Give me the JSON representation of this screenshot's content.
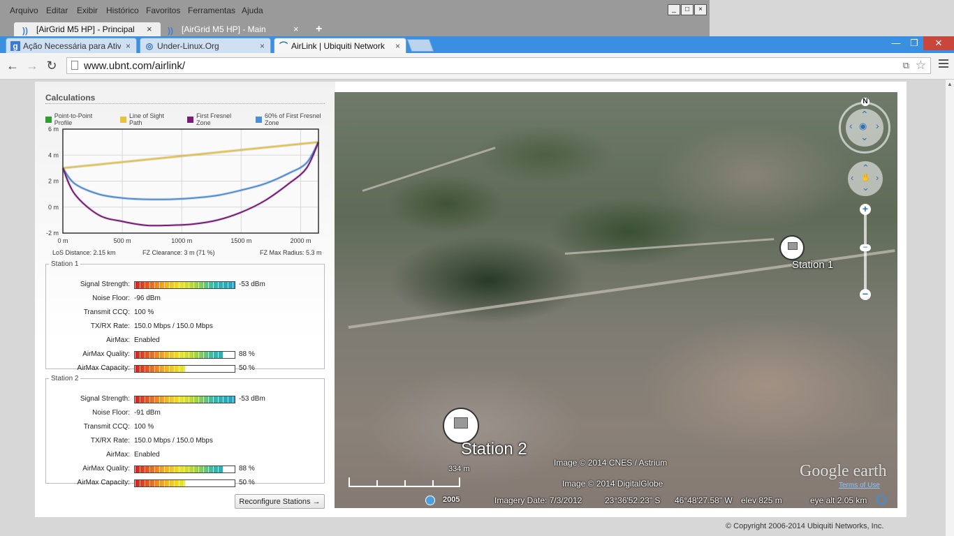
{
  "firefox": {
    "menu": [
      "Arquivo",
      "Editar",
      "Exibir",
      "Histórico",
      "Favoritos",
      "Ferramentas",
      "Ajuda"
    ],
    "tabs": [
      {
        "label": "[AirGrid M5 HP] - Principal",
        "close": "×"
      },
      {
        "label": "[AirGrid M5 HP] - Main",
        "close": "×"
      }
    ],
    "new_tab": "+",
    "window_controls": [
      "_",
      "□",
      "×"
    ]
  },
  "chrome": {
    "tabs": [
      {
        "label": "Ação Necessária para Ativ",
        "icon": "g",
        "close": "×"
      },
      {
        "label": "Under-Linux.Org",
        "icon": "◎",
        "close": "×"
      },
      {
        "label": "AirLink | Ubiquiti Network",
        "icon": "⌒",
        "close": "×"
      }
    ],
    "window_controls": {
      "minimize": "—",
      "restore": "❐",
      "close": "✕"
    },
    "back": "←",
    "forward": "→",
    "reload": "↻",
    "url": "www.ubnt.com/airlink/",
    "translate_icon": "⧉",
    "star_icon": "☆"
  },
  "calc": {
    "title": "Calculations",
    "legend": [
      {
        "label": "Point-to-Point Profile",
        "color": "#2aa12a"
      },
      {
        "label": "Line of Sight Path",
        "color": "#e8c23a"
      },
      {
        "label": "First Fresnel Zone",
        "color": "#7a1b7a"
      },
      {
        "label": "60% of First Fresnel Zone",
        "color": "#4a90d9"
      }
    ],
    "stats": {
      "los_distance": "LoS Distance: 2.15 km",
      "fz_clearance": "FZ Clearance: 3 m  (71 %)",
      "fz_radius": "FZ Max Radius: 5.3 m"
    }
  },
  "chart_data": {
    "type": "line",
    "title": "",
    "xlabel": "",
    "ylabel": "",
    "xlim": [
      0,
      2150
    ],
    "ylim": [
      -2,
      6
    ],
    "x_ticks": [
      "0 m",
      "500 m",
      "1000 m",
      "1500 m",
      "2000 m"
    ],
    "x_tick_values": [
      0,
      500,
      1000,
      1500,
      2000
    ],
    "y_ticks": [
      "6 m",
      "4 m",
      "2 m",
      "0 m",
      "-2 m"
    ],
    "y_tick_values": [
      6,
      4,
      2,
      0,
      -2
    ],
    "grid": true,
    "legend_position": "top",
    "series": [
      {
        "name": "Line of Sight Path",
        "color": "#e8c23a",
        "x": [
          0,
          2150
        ],
        "y": [
          3.0,
          5.0
        ]
      },
      {
        "name": "60% of First Fresnel Zone",
        "color": "#4a90d9",
        "x": [
          0,
          100,
          300,
          500,
          700,
          900,
          1100,
          1300,
          1500,
          1700,
          1900,
          2050,
          2150
        ],
        "y": [
          3.0,
          1.8,
          1.0,
          0.7,
          0.6,
          0.6,
          0.7,
          0.9,
          1.3,
          1.8,
          2.6,
          3.4,
          5.0
        ]
      },
      {
        "name": "First Fresnel Zone",
        "color": "#7a1b7a",
        "x": [
          0,
          100,
          300,
          500,
          700,
          900,
          1100,
          1300,
          1500,
          1700,
          1900,
          2050,
          2150
        ],
        "y": [
          3.0,
          1.0,
          -0.6,
          -1.1,
          -1.4,
          -1.4,
          -1.3,
          -1.0,
          -0.4,
          0.5,
          1.8,
          3.0,
          5.0
        ]
      }
    ]
  },
  "station1": {
    "title": "Station 1",
    "rows": [
      {
        "label": "Signal Strength:",
        "meter": 1.0,
        "value": "-53 dBm"
      },
      {
        "label": "Noise Floor:",
        "value": "-96 dBm"
      },
      {
        "label": "Transmit CCQ:",
        "value": "100 %"
      },
      {
        "label": "TX/RX Rate:",
        "value": "150.0 Mbps / 150.0 Mbps"
      },
      {
        "label": "AirMax:",
        "value": "Enabled"
      },
      {
        "label": "AirMax Quality:",
        "meter": 0.88,
        "value": "88 %"
      },
      {
        "label": "AirMax Capacity:",
        "meter": 0.5,
        "value": "50 %"
      }
    ]
  },
  "station2": {
    "title": "Station 2",
    "rows": [
      {
        "label": "Signal Strength:",
        "meter": 1.0,
        "value": "-53 dBm"
      },
      {
        "label": "Noise Floor:",
        "value": "-91 dBm"
      },
      {
        "label": "Transmit CCQ:",
        "value": "100 %"
      },
      {
        "label": "TX/RX Rate:",
        "value": "150.0 Mbps / 150.0 Mbps"
      },
      {
        "label": "AirMax:",
        "value": "Enabled"
      },
      {
        "label": "AirMax Quality:",
        "meter": 0.88,
        "value": "88 %"
      },
      {
        "label": "AirMax Capacity:",
        "meter": 0.5,
        "value": "50 %"
      }
    ]
  },
  "reconfigure_button": "Reconfigure Stations →",
  "map": {
    "station1_label": "Station 1",
    "station2_label": "Station 2",
    "north": "N",
    "zoom_in": "+",
    "zoom_out": "−",
    "image_credit_1": "Image © 2014 CNES / Astrium",
    "image_credit_2": "Image © 2014 DigitalGlobe",
    "scale_label": "334 m",
    "year": "2005",
    "imagery_date": "Imagery Date: 7/3/2012",
    "lat": "23°36'52.23\" S",
    "lon": "46°48'27.58\" W",
    "elev": "elev   825 m",
    "eye_alt": "eye alt   2.05 km",
    "logo": "Google earth",
    "terms": "Terms of Use"
  },
  "copyright": "© Copyright 2006-2014 Ubiquiti Networks, Inc."
}
